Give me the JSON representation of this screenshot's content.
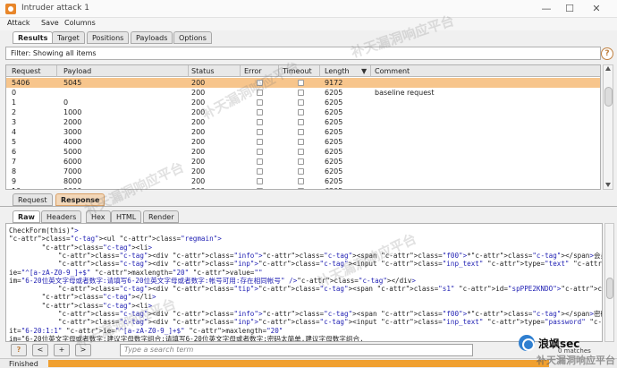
{
  "window": {
    "title": "Intruder attack 1",
    "min": "—",
    "max": "☐",
    "close": "✕"
  },
  "menu": [
    "Attack",
    "Save",
    "Columns"
  ],
  "tabs": [
    "Results",
    "Target",
    "Positions",
    "Payloads",
    "Options"
  ],
  "filter": "Filter: Showing all items",
  "help": "?",
  "table": {
    "headers": [
      "Request",
      "Payload",
      "Status",
      "Error",
      "Timeout",
      "Length",
      "Comment"
    ],
    "sort_icon": "▼",
    "rows": [
      {
        "request": "5406",
        "payload": "5045",
        "status": "200",
        "length": "9172",
        "comment": "",
        "selected": true
      },
      {
        "request": "0",
        "payload": "",
        "status": "200",
        "length": "6205",
        "comment": "baseline request"
      },
      {
        "request": "1",
        "payload": "0",
        "status": "200",
        "length": "6205",
        "comment": ""
      },
      {
        "request": "2",
        "payload": "1000",
        "status": "200",
        "length": "6205",
        "comment": ""
      },
      {
        "request": "3",
        "payload": "2000",
        "status": "200",
        "length": "6205",
        "comment": ""
      },
      {
        "request": "4",
        "payload": "3000",
        "status": "200",
        "length": "6205",
        "comment": ""
      },
      {
        "request": "5",
        "payload": "4000",
        "status": "200",
        "length": "6205",
        "comment": ""
      },
      {
        "request": "6",
        "payload": "5000",
        "status": "200",
        "length": "6205",
        "comment": ""
      },
      {
        "request": "7",
        "payload": "6000",
        "status": "200",
        "length": "6205",
        "comment": ""
      },
      {
        "request": "8",
        "payload": "7000",
        "status": "200",
        "length": "6205",
        "comment": ""
      },
      {
        "request": "9",
        "payload": "8000",
        "status": "200",
        "length": "6205",
        "comment": ""
      },
      {
        "request": "10",
        "payload": "9000",
        "status": "200",
        "length": "6205",
        "comment": ""
      }
    ]
  },
  "rr_tabs": [
    "Request",
    "Response"
  ],
  "sub_tabs": [
    "Raw",
    "Headers",
    "Hex",
    "HTML",
    "Render"
  ],
  "code": [
    "CheckForm(this)\">",
    "<ul class=\"regmain\">",
    "        <li>",
    "            <div class=\"info\"><span class=\"f00\">*</span>会员帐号</div>",
    "            <div class=\"inp\"><input class=\"inp_text\" type=\"text\" id=\"PPE2KNDO\" name=\"PPE2KNDO\" it=\"6-20:1:1\"",
    "ie=\"^[a-zA-Z0-9_]+$\" maxlength=\"20\" value=\"\"",
    "im=\"6-20位英文字母或者数字:请填写6-20位英文字母或者数字:帐号可用:存在相同帐号\" /></div>",
    "            <div class=\"tip\"><span class=\"s1\" id=\"spPPE2KNDO\"></span></div>",
    "        </li>",
    "        <li>",
    "            <div class=\"info\"><span class=\"f00\">*</span>密码</div>",
    "            <div class=\"inp\"><input class=\"inp_text\" type=\"password\" id=\"CYYYHIUI\" name=\"CYYYHIUI\"",
    "it=\"6-20:1:1\" ie=\"^[a-zA-Z0-9_]+$\" maxlength=\"20\"",
    "im=\"6-20位英文字母或者数字:建议字母数字组合:请填写6-20位英文字母或者数字:密码太简单,建议字母数字组合,"
  ],
  "search": {
    "buttons": [
      "?",
      "<",
      "+",
      ">"
    ],
    "placeholder": "Type a search term",
    "matches": "0 matches"
  },
  "status": "Finished",
  "watermark": "补天漏洞响应平台",
  "brand": "浪飒sec"
}
